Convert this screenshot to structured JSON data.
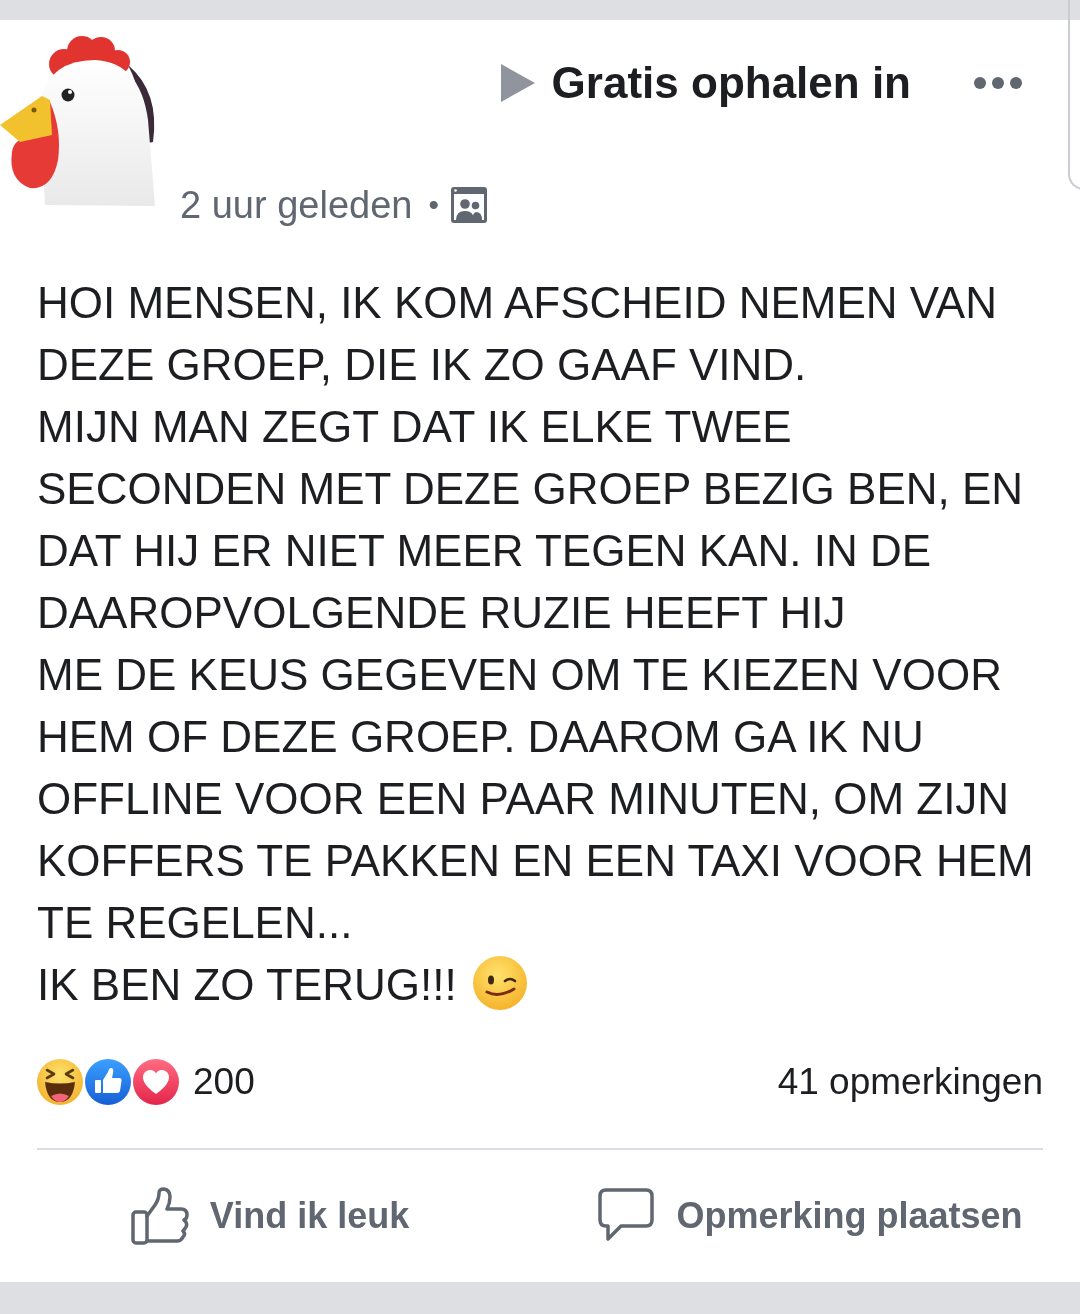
{
  "post": {
    "group_name": "Gratis ophalen in",
    "timestamp": "2 uur geleden",
    "meta_separator": "•",
    "paragraphs": [
      "HOI MENSEN, IK KOM AFSCHEID NEMEN VAN DEZE GROEP, DIE IK ZO GAAF VIND.",
      "MIJN MAN ZEGT DAT IK ELKE TWEE SECONDEN MET DEZE GROEP BEZIG BEN, EN DAT HIJ ER NIET MEER TEGEN KAN. IN DE DAAROPVOLGENDE RUZIE HEEFT HIJ",
      "ME DE KEUS GEGEVEN OM TE KIEZEN VOOR HEM OF DEZE GROEP. DAAROM GA IK NU OFFLINE VOOR EEN PAAR MINUTEN, OM ZIJN KOFFERS TE PAKKEN EN EEN TAXI VOOR HEM TE REGELEN...",
      "IK BEN ZO TERUG!!!"
    ],
    "reaction_count": "200",
    "comment_count": "41 opmerkingen",
    "actions": [
      {
        "kind": "like",
        "label": "Vind ik leuk"
      },
      {
        "kind": "comment",
        "label": "Opmerking plaatsen"
      }
    ]
  }
}
